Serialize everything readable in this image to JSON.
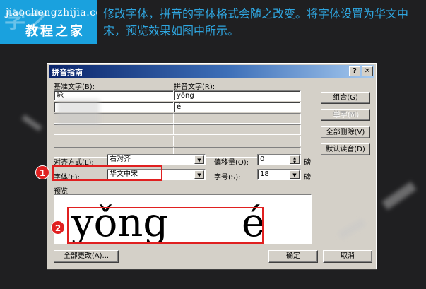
{
  "banner": {
    "watermark_big": "学之",
    "watermark_url": "jiaochengzhijia.com",
    "watermark_cn": "教程之家",
    "caption": "修改字体，拼音的字体格式会随之改变。将字体设置为华文中宋，预览效果如图中所示。"
  },
  "dialog": {
    "title": "拼音指南",
    "help_btn": "?",
    "close_btn": "✕",
    "base_text_label": "基准文字(B):",
    "pinyin_text_label": "拼音文字(R):",
    "base_rows": [
      "咏",
      "",
      "",
      "",
      "",
      ""
    ],
    "pinyin_rows": [
      "yǒng",
      "é",
      "",
      "",
      "",
      ""
    ],
    "buttons": {
      "combine": "组合(G)",
      "single": "单字(M)",
      "delete_all": "全部删除(V)",
      "default_reading": "默认读音(D)",
      "change_all": "全部更改(A)...",
      "ok": "确定",
      "cancel": "取消"
    },
    "align_label": "对齐方式(L):",
    "align_value": "右对齐",
    "offset_label": "偏移量(O):",
    "offset_value": "0",
    "offset_unit": "磅",
    "font_label": "字体(F):",
    "font_value": "华文中宋",
    "size_label": "字号(S):",
    "size_value": "18",
    "size_unit": "磅",
    "preview_label": "预览",
    "preview_pinyin_1": "yǒng",
    "preview_pinyin_2": "é"
  },
  "annotations": {
    "badge_1": "1",
    "badge_2": "2",
    "highlight_color": "#e02020"
  }
}
